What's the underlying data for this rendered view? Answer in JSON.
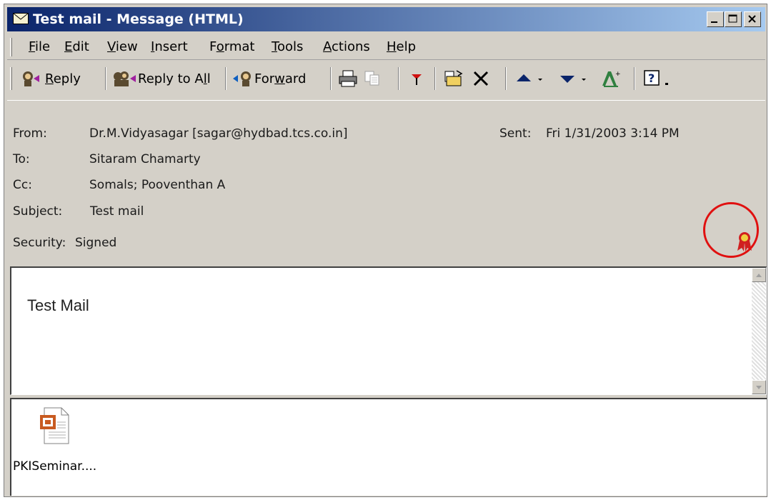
{
  "window": {
    "title": "Test mail - Message (HTML)"
  },
  "menu": {
    "items": [
      {
        "pre": "",
        "ul": "F",
        "post": "ile"
      },
      {
        "pre": "",
        "ul": "E",
        "post": "dit"
      },
      {
        "pre": "",
        "ul": "V",
        "post": "iew"
      },
      {
        "pre": "",
        "ul": "I",
        "post": "nsert"
      },
      {
        "pre": "F",
        "ul": "o",
        "post": "rmat"
      },
      {
        "pre": "",
        "ul": "T",
        "post": "ools"
      },
      {
        "pre": "",
        "ul": "A",
        "post": "ctions"
      },
      {
        "pre": "",
        "ul": "H",
        "post": "elp"
      }
    ]
  },
  "toolbar": {
    "reply": {
      "pre": "",
      "ul": "R",
      "post": "eply"
    },
    "reply_all": {
      "pre": "Reply to A",
      "ul": "l",
      "post": "l"
    },
    "forward": {
      "pre": "For",
      "ul": "w",
      "post": "ard"
    }
  },
  "headers": {
    "from_label": "From:",
    "from_value": "Dr.M.Vidyasagar [sagar@hydbad.tcs.co.in]",
    "sent_label": "Sent:",
    "sent_value": "Fri 1/31/2003 3:14 PM",
    "to_label": "To:",
    "to_value": "Sitaram Chamarty",
    "cc_label": "Cc:",
    "cc_value": "Somals; Pooventhan A",
    "subject_label": "Subject:",
    "subject_value": "Test mail",
    "security_label": "Security:",
    "security_value": "Signed"
  },
  "message": {
    "body": "Test Mail"
  },
  "attachment": {
    "name": "PKISeminar...."
  },
  "colors": {
    "title_gradient_start": "#0a246a",
    "title_gradient_end": "#a6caf0",
    "highlight_circle": "#e01010",
    "window_face": "#d4d0c8"
  },
  "icons": [
    "envelope-icon",
    "reply-icon",
    "reply-all-icon",
    "forward-icon",
    "print-icon",
    "copy-icon",
    "flag-icon",
    "move-to-folder-icon",
    "delete-icon",
    "previous-item-icon",
    "next-item-icon",
    "address-book-icon",
    "help-icon",
    "certificate-icon",
    "powerpoint-file-icon"
  ]
}
